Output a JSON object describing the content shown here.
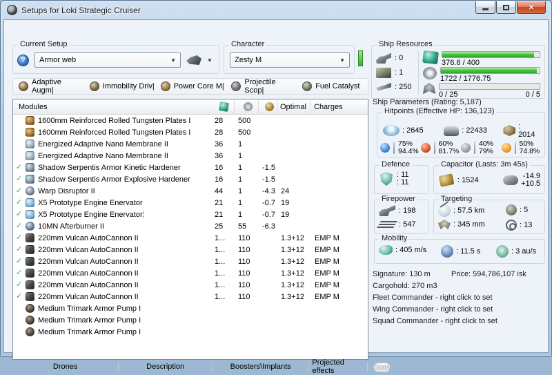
{
  "window": {
    "title": "Setups for Loki Strategic Cruiser"
  },
  "current_setup": {
    "label": "Current Setup",
    "value": "Armor web"
  },
  "character": {
    "label": "Character",
    "value": "Zesty M"
  },
  "subsystems": [
    {
      "label": "Adaptive Augm|",
      "icon": "subsys-armor"
    },
    {
      "label": "Immobility Driv|",
      "icon": "subsys-prop"
    },
    {
      "label": "Power Core M|",
      "icon": "subsys-core"
    },
    {
      "label": "Projectile Scop|",
      "icon": "subsys-offense"
    },
    {
      "label": "Fuel Catalyst",
      "icon": "subsys-engineering"
    }
  ],
  "module_table": {
    "header": {
      "modules": "Modules",
      "optimal": "Optimal",
      "charges": "Charges"
    },
    "header_icons": [
      "cpu-icon",
      "powergrid-icon",
      "capacitor-icon"
    ],
    "rows": [
      {
        "active": false,
        "focused": false,
        "icon": "icon-plate",
        "name": "1600mm Reinforced Rolled Tungsten Plates I",
        "cpu": "28",
        "pg": "500",
        "cap": "",
        "optimal": "",
        "charges": ""
      },
      {
        "active": false,
        "focused": false,
        "icon": "icon-plate",
        "name": "1600mm Reinforced Rolled Tungsten Plates I",
        "cpu": "28",
        "pg": "500",
        "cap": "",
        "optimal": "",
        "charges": ""
      },
      {
        "active": false,
        "focused": false,
        "icon": "icon-membrane",
        "name": "Energized Adaptive Nano Membrane II",
        "cpu": "36",
        "pg": "1",
        "cap": "",
        "optimal": "",
        "charges": ""
      },
      {
        "active": false,
        "focused": false,
        "icon": "icon-membrane",
        "name": "Energized Adaptive Nano Membrane II",
        "cpu": "36",
        "pg": "1",
        "cap": "",
        "optimal": "",
        "charges": ""
      },
      {
        "active": true,
        "focused": false,
        "icon": "icon-hardener",
        "name": "Shadow Serpentis Armor Kinetic Hardener",
        "cpu": "16",
        "pg": "1",
        "cap": "-1.5",
        "optimal": "",
        "charges": ""
      },
      {
        "active": true,
        "focused": false,
        "icon": "icon-hardener",
        "name": "Shadow Serpentis Armor Explosive Hardener",
        "cpu": "16",
        "pg": "1",
        "cap": "-1.5",
        "optimal": "",
        "charges": ""
      },
      {
        "active": true,
        "focused": false,
        "icon": "icon-disruptor",
        "name": "Warp Disruptor II",
        "cpu": "44",
        "pg": "1",
        "cap": "-4.3",
        "optimal": "24",
        "charges": ""
      },
      {
        "active": true,
        "focused": false,
        "icon": "icon-web",
        "name": "X5 Prototype Engine Enervator",
        "cpu": "21",
        "pg": "1",
        "cap": "-0.7",
        "optimal": "19",
        "charges": ""
      },
      {
        "active": true,
        "focused": true,
        "icon": "icon-web",
        "name": "X5 Prototype Engine Enervator",
        "cpu": "21",
        "pg": "1",
        "cap": "-0.7",
        "optimal": "19",
        "charges": ""
      },
      {
        "active": true,
        "focused": false,
        "icon": "icon-afterburner",
        "name": "10MN Afterburner II",
        "cpu": "25",
        "pg": "55",
        "cap": "-6.3",
        "optimal": "",
        "charges": ""
      },
      {
        "active": true,
        "focused": false,
        "icon": "icon-gun",
        "name": "220mm Vulcan AutoCannon II",
        "cpu": "1...",
        "pg": "110",
        "cap": "",
        "optimal": "1.3+12",
        "charges": "EMP M"
      },
      {
        "active": true,
        "focused": false,
        "icon": "icon-gun",
        "name": "220mm Vulcan AutoCannon II",
        "cpu": "1...",
        "pg": "110",
        "cap": "",
        "optimal": "1.3+12",
        "charges": "EMP M"
      },
      {
        "active": true,
        "focused": false,
        "icon": "icon-gun",
        "name": "220mm Vulcan AutoCannon II",
        "cpu": "1...",
        "pg": "110",
        "cap": "",
        "optimal": "1.3+12",
        "charges": "EMP M"
      },
      {
        "active": true,
        "focused": false,
        "icon": "icon-gun",
        "name": "220mm Vulcan AutoCannon II",
        "cpu": "1...",
        "pg": "110",
        "cap": "",
        "optimal": "1.3+12",
        "charges": "EMP M"
      },
      {
        "active": true,
        "focused": false,
        "icon": "icon-gun",
        "name": "220mm Vulcan AutoCannon II",
        "cpu": "1...",
        "pg": "110",
        "cap": "",
        "optimal": "1.3+12",
        "charges": "EMP M"
      },
      {
        "active": true,
        "focused": false,
        "icon": "icon-gun",
        "name": "220mm Vulcan AutoCannon II",
        "cpu": "1...",
        "pg": "110",
        "cap": "",
        "optimal": "1.3+12",
        "charges": "EMP M"
      },
      {
        "active": false,
        "focused": false,
        "icon": "icon-rig",
        "name": "Medium Trimark Armor Pump I",
        "cpu": "",
        "pg": "",
        "cap": "",
        "optimal": "",
        "charges": ""
      },
      {
        "active": false,
        "focused": false,
        "icon": "icon-rig",
        "name": "Medium Trimark Armor Pump I",
        "cpu": "",
        "pg": "",
        "cap": "",
        "optimal": "",
        "charges": ""
      },
      {
        "active": false,
        "focused": false,
        "icon": "icon-rig",
        "name": "Medium Trimark Armor Pump I",
        "cpu": "",
        "pg": "",
        "cap": "",
        "optimal": "",
        "charges": ""
      }
    ]
  },
  "bottom_bar": {
    "tabs": [
      {
        "label": "Drones"
      },
      {
        "label": "Description"
      },
      {
        "label": "Boosters\\Implants"
      },
      {
        "label": "Projected effects"
      }
    ],
    "stats_label": "Stats"
  },
  "ship_resources": {
    "label": "Ship Resources",
    "turrets": ": 0",
    "launchers": ": 1",
    "calibration": ": 250",
    "cpu_text": "376.6 / 400",
    "cpu_pct": 94,
    "powergrid_text": "1722 / 1776.75",
    "powergrid_pct": 97,
    "drones_left": "0 / 25",
    "drones_right": "0 / 5",
    "drones_pct": 0
  },
  "ship_parameters": {
    "title": "Ship Parameters (Rating: 5,187)",
    "hitpoints_label": "Hitpoints (Effective HP: 136,123)",
    "shield": ": 2645",
    "armor": ": 22433",
    "structure": ": 2014",
    "resists": [
      {
        "type": "em",
        "top": "75%",
        "bottom": "94.4%"
      },
      {
        "type": "thermal",
        "top": "60%",
        "bottom": "81.7%"
      },
      {
        "type": "kinetic",
        "top": "40%",
        "bottom": "79%"
      },
      {
        "type": "explosive",
        "top": "50%",
        "bottom": "74.8%"
      }
    ],
    "defence": {
      "label": "Defence",
      "value1": ": 11",
      "value2": ": 11"
    },
    "capacitor": {
      "label": "Capacitor (Lasts: 3m 45s)",
      "amount": ": 1524",
      "peak_neg": "-14.9",
      "peak_pos": "+10.5"
    },
    "firepower": {
      "label": "Firepower",
      "volley": ": 198",
      "dps": ": 547"
    },
    "targeting": {
      "label": "Targeting",
      "range": ": 57.5 km",
      "max_targets": ": 5",
      "scan_resolution": ": 345 mm",
      "sensor_strength": ": 13"
    },
    "mobility": {
      "label": "Mobility",
      "speed": ": 405 m/s",
      "align_time": ": 11.5 s",
      "warp_speed": ": 3 au/s"
    },
    "info": {
      "signature": "Signature: 130 m",
      "price": "Price: 594,786,107 isk",
      "cargohold": "Cargohold: 270 m3",
      "fleet": "Fleet Commander - right click to set",
      "wing": "Wing Commander - right click to set",
      "squad": "Squad Commander - right click to set"
    }
  },
  "colors": {
    "accent_green_bar": "#49c93f",
    "check_green": "#3fae49",
    "titlebar_blue": "#b4cde6",
    "close_button_red": "#c5441f"
  }
}
